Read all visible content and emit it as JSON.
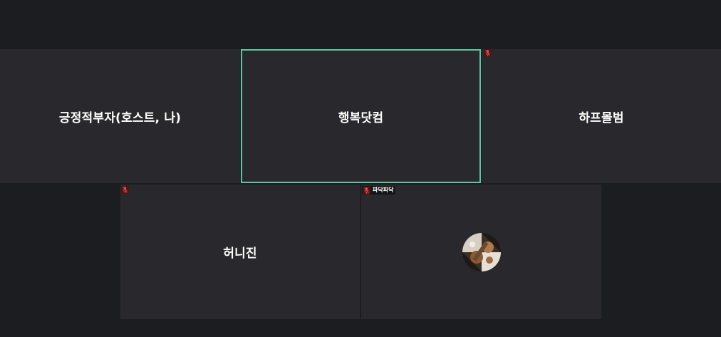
{
  "colors": {
    "background": "#1c1d21",
    "tile": "#28282d",
    "active_speaker_border": "#5fc6a0",
    "muted_icon_bg": "#4a1616",
    "muted_icon_fg": "#e04848"
  },
  "participants": [
    {
      "name": "긍정적부자(호스트, 나)",
      "muted": false,
      "active_speaker": false
    },
    {
      "name": "행복닷컴",
      "muted": false,
      "active_speaker": true
    },
    {
      "name": "하프몰범",
      "muted": true,
      "active_speaker": false
    },
    {
      "name": "허니진",
      "muted": true,
      "active_speaker": false
    },
    {
      "name": "",
      "label": "파닥파닥",
      "muted": true,
      "has_avatar": true,
      "active_speaker": false
    }
  ],
  "icons": {
    "mute": "microphone-muted-icon",
    "avatar": "participant-avatar"
  }
}
